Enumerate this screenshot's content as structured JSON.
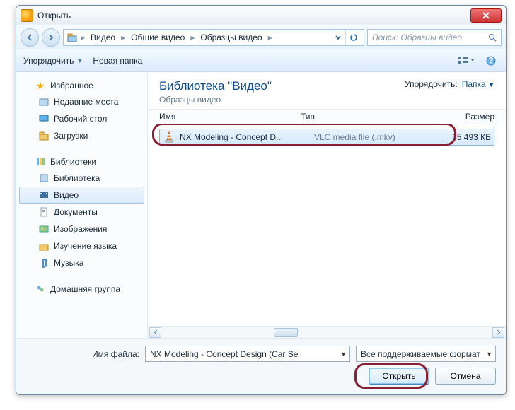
{
  "window": {
    "title": "Открыть"
  },
  "nav": {
    "crumbs": [
      "Видео",
      "Общие видео",
      "Образцы видео"
    ],
    "search_placeholder": "Поиск: Образцы видео"
  },
  "toolbar": {
    "organize": "Упорядочить",
    "new_folder": "Новая папка"
  },
  "sidebar": {
    "favorites": {
      "label": "Избранное",
      "items": [
        "Недавние места",
        "Рабочий стол",
        "Загрузки"
      ]
    },
    "libraries": {
      "label": "Библиотеки",
      "items": [
        "Библиотека",
        "Видео",
        "Документы",
        "Изображения",
        "Изучение языка",
        "Музыка"
      ]
    },
    "homegroup": {
      "label": "Домашняя группа"
    }
  },
  "library_header": {
    "title": "Библиотека \"Видео\"",
    "subtitle": "Образцы видео",
    "sort_label": "Упорядочить:",
    "sort_value": "Папка"
  },
  "columns": {
    "name": "Имя",
    "type": "Тип",
    "size": "Размер"
  },
  "files": [
    {
      "name": "NX Modeling - Concept D...",
      "type": "VLC media file (.mkv)",
      "size": "35 493 КБ"
    }
  ],
  "footer": {
    "filename_label": "Имя файла:",
    "filename_value": "NX Modeling - Concept Design (Car Se",
    "filetype_value": "Все поддерживаемые формат",
    "open": "Открыть",
    "cancel": "Отмена"
  }
}
